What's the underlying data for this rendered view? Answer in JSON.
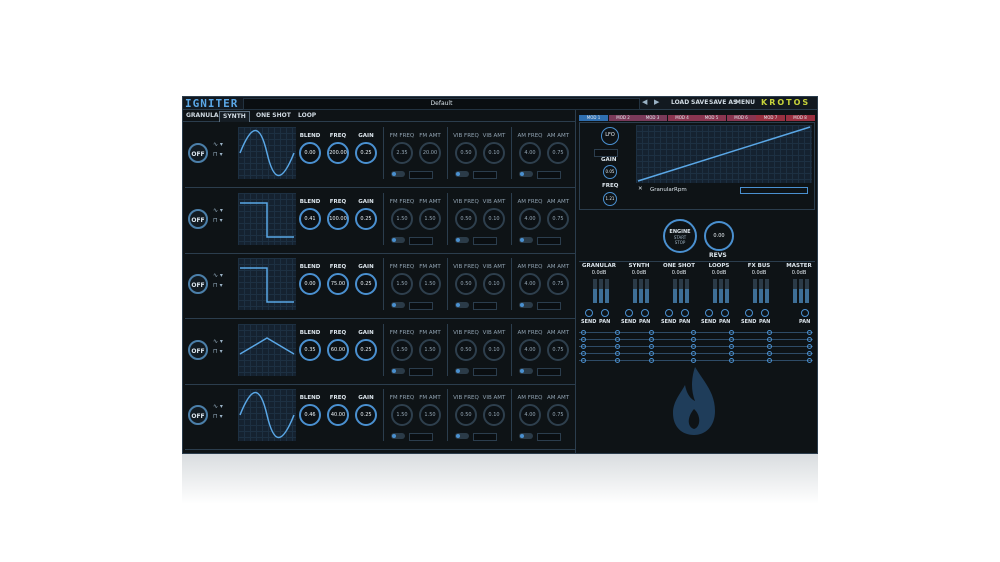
{
  "app": {
    "logo": "IGNITER",
    "preset": "Default",
    "brand": "KROTOS"
  },
  "header": {
    "prev": "◀",
    "next": "▶",
    "load": "LOAD",
    "save": "SAVE",
    "save_as": "SAVE AS",
    "menu": "MENU"
  },
  "tabs": [
    "GRANULAR",
    "SYNTH",
    "ONE SHOT",
    "LOOP"
  ],
  "active_tab": "SYNTH",
  "labels": {
    "off": "OFF",
    "blend": "BLEND",
    "freq": "FREQ",
    "gain": "GAIN",
    "fm_freq": "FM FREQ",
    "fm_amt": "FM AMT",
    "vib_freq": "VIB FREQ",
    "vib_amt": "VIB AMT",
    "am_freq": "AM FREQ",
    "am_amt": "AM AMT"
  },
  "rows": [
    {
      "wave": "sine",
      "blend": "0.00",
      "freq": "200.00",
      "gain": "0.25",
      "fm_freq": "2.35",
      "fm_amt": "20.00",
      "vib_freq": "0.50",
      "vib_amt": "0.10",
      "am_freq": "4.00",
      "am_amt": "0.75"
    },
    {
      "wave": "square",
      "blend": "0.41",
      "freq": "100.00",
      "gain": "0.25",
      "fm_freq": "1.50",
      "fm_amt": "1.50",
      "vib_freq": "0.50",
      "vib_amt": "0.10",
      "am_freq": "4.00",
      "am_amt": "0.75"
    },
    {
      "wave": "square",
      "blend": "0.00",
      "freq": "75.00",
      "gain": "0.25",
      "fm_freq": "1.50",
      "fm_amt": "1.50",
      "vib_freq": "0.50",
      "vib_amt": "0.10",
      "am_freq": "4.00",
      "am_amt": "0.75"
    },
    {
      "wave": "triangle",
      "blend": "0.35",
      "freq": "60.00",
      "gain": "0.25",
      "fm_freq": "1.50",
      "fm_amt": "1.50",
      "vib_freq": "0.50",
      "vib_amt": "0.10",
      "am_freq": "4.00",
      "am_amt": "0.75"
    },
    {
      "wave": "sine",
      "blend": "0.46",
      "freq": "40.00",
      "gain": "0.25",
      "fm_freq": "1.50",
      "fm_amt": "1.50",
      "vib_freq": "0.50",
      "vib_amt": "0.10",
      "am_freq": "4.00",
      "am_amt": "0.75"
    }
  ],
  "mod": {
    "tabs": [
      "MOD 1",
      "MOD 2",
      "MOD 3",
      "MOD 4",
      "MOD 5",
      "MOD 6",
      "MOD 7",
      "MOD 8"
    ],
    "lfo": "LFO",
    "gain_label": "GAIN",
    "gain_value": "0.05",
    "freq_label": "FREQ",
    "freq_value": "1.21",
    "target": "GranularRpm",
    "close": "✕"
  },
  "engine": {
    "label": "ENGINE",
    "start": "START",
    "stop": "STOP",
    "revs_value": "0.00",
    "revs_label": "REVS"
  },
  "mixer": {
    "channels": [
      {
        "name": "GRANULAR",
        "db": "0.0dB"
      },
      {
        "name": "SYNTH",
        "db": "0.0dB"
      },
      {
        "name": "ONE SHOT",
        "db": "0.0dB"
      },
      {
        "name": "LOOPS",
        "db": "0.0dB"
      },
      {
        "name": "FX BUS",
        "db": "0.0dB"
      },
      {
        "name": "MASTER",
        "db": "0.0dB"
      }
    ],
    "send": "SEND",
    "pan": "PAN"
  },
  "colors": {
    "accent": "#4a90d0",
    "brand": "#c6d33a",
    "bg": "#0e1316"
  }
}
